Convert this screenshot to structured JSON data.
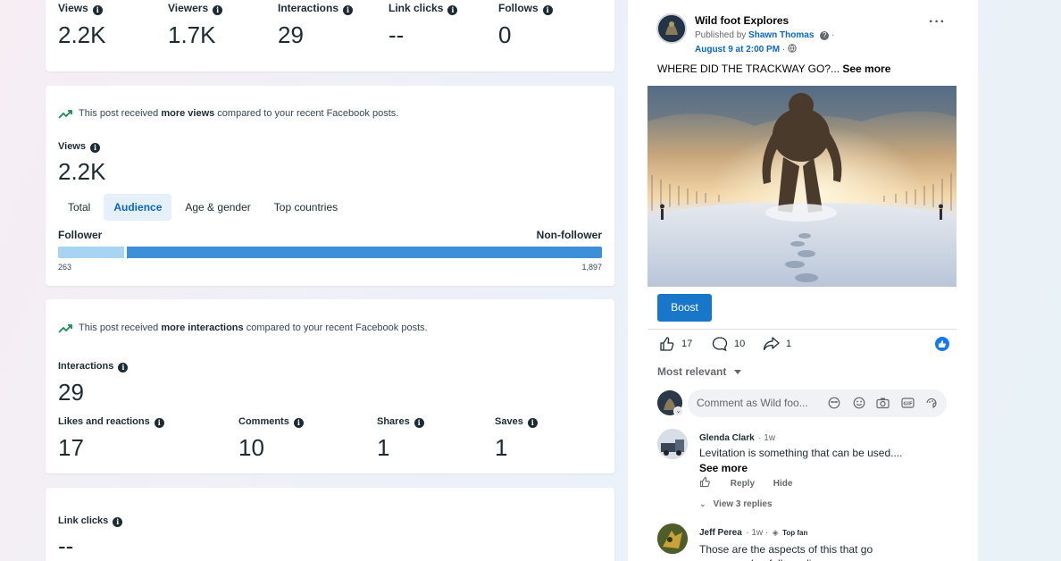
{
  "summary": {
    "metrics": [
      {
        "label": "Views",
        "value": "2.2K"
      },
      {
        "label": "Viewers",
        "value": "1.7K"
      },
      {
        "label": "Interactions",
        "value": "29"
      },
      {
        "label": "Link clicks",
        "value": "--"
      },
      {
        "label": "Follows",
        "value": "0"
      }
    ]
  },
  "views_card": {
    "trend_prefix": "This post received ",
    "trend_bold": "more views",
    "trend_suffix": " compared to your recent Facebook posts.",
    "label": "Views",
    "value": "2.2K",
    "tabs": [
      "Total",
      "Audience",
      "Age & gender",
      "Top countries"
    ],
    "active_tab": "Audience",
    "follower_label": "Follower",
    "nonfollower_label": "Non-follower",
    "follower_count": "263",
    "nonfollower_count": "1,897",
    "follower_value": 263,
    "nonfollower_value": 1897
  },
  "interactions_card": {
    "trend_prefix": "This post received ",
    "trend_bold": "more interactions",
    "trend_suffix": " compared to your recent Facebook posts.",
    "label": "Interactions",
    "value": "29",
    "breakdown": [
      {
        "label": "Likes and reactions",
        "value": "17"
      },
      {
        "label": "Comments",
        "value": "10"
      },
      {
        "label": "Shares",
        "value": "1"
      },
      {
        "label": "Saves",
        "value": "1"
      }
    ]
  },
  "linkclicks_card": {
    "label": "Link clicks",
    "value": "--"
  },
  "post": {
    "page_name": "Wild foot Explores",
    "published_prefix": "Published by ",
    "publisher": "Shawn Thomas",
    "date": "August 9 at 2:00 PM",
    "text": "WHERE DID THE TRACKWAY GO?... ",
    "see_more": "See more",
    "boost": "Boost",
    "likes": "17",
    "comments": "10",
    "shares": "1",
    "sort_label": "Most relevant",
    "comment_placeholder": "Comment as Wild foo...",
    "comments_list": [
      {
        "name": "Glenda Clark",
        "meta": "· 1w",
        "text": "Levitation is something that can be used....",
        "see_more": "See more",
        "reply": "Reply",
        "hide": "Hide",
        "view_replies": "View 3 replies"
      },
      {
        "name": "Jeff Perea",
        "meta": "· 1w ·",
        "badge": "Top fan",
        "text": "Those are the aspects of this that go paranormal or full on alien"
      }
    ]
  },
  "colors": {
    "accent": "#0a66c2",
    "bar_light": "#a8d3f2",
    "bar_dark": "#3d8fd8",
    "trend_green": "#1e8a4f"
  }
}
